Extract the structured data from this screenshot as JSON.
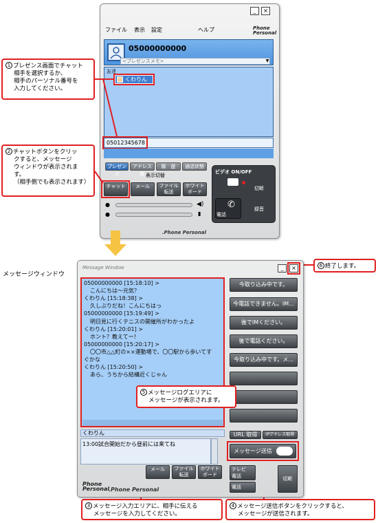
{
  "phone_app": {
    "menu": [
      "ファイル",
      "表示",
      "設定",
      "ヘルプ"
    ],
    "logo_lines": [
      "Phone",
      "Personal"
    ],
    "user_number": "05000000000",
    "presence_memo": "<プレゼンスメモ>",
    "group_label": "友達",
    "selected_contact": "くわりん",
    "personal_number_input": "05012345678",
    "tabs": [
      "プレゼンス",
      "アドレス帳",
      "履　歴",
      "通話状態"
    ],
    "tabs_caption": "表示切替",
    "chat_button": "チャット",
    "mail_button": "メール",
    "file_button": [
      "ファイル",
      "転送"
    ],
    "whiteboard_button": [
      "ホワイト",
      "ボード"
    ],
    "video_toggle": "ビデオ ON/OFF",
    "call_button": "電話",
    "hangup_label": "切断",
    "record_label": "録音",
    "footer_brand": ".Phone Personal"
  },
  "message_window": {
    "outside_label": "メッセージウィンドウ",
    "title": "Message Window",
    "log": [
      {
        "text": "05000000000 [15:18:10] >",
        "indent": false
      },
      {
        "text": "こんにちは～元気？",
        "indent": true
      },
      {
        "text": "くわりん [15:18:38] >",
        "indent": false
      },
      {
        "text": "久しぶりだね！こんにちはっ",
        "indent": true
      },
      {
        "text": "05000000000 [15:19:49] >",
        "indent": false
      },
      {
        "text": "明日見に行くテニスの開催所がわかったよ",
        "indent": true
      },
      {
        "text": "くわりん [15:20:01] >",
        "indent": false
      },
      {
        "text": "ホント？教えてー！",
        "indent": true
      },
      {
        "text": "05000000000 [15:20:17] >",
        "indent": false
      },
      {
        "text": "〇〇市△△町の××運動場で、〇〇駅から歩いてす",
        "indent": true
      },
      {
        "text": "ぐかな",
        "indent": false
      },
      {
        "text": "くわりん [15:20:50] >",
        "indent": false
      },
      {
        "text": "あら、うちから結構近くじゃん",
        "indent": true
      }
    ],
    "quick_replies": [
      "今取り込み中です。",
      "今電話できません。IM...",
      "後でIMください。",
      "後で電話ください。",
      "今取り込み中です。メ..."
    ],
    "recipient_name": "くわりん",
    "input_text": "13:00試合開始だから昼前には来てね",
    "url_button": "URL 取得",
    "ip_button": "IPアドレス取得",
    "send_button": "メッセージ送信",
    "mail_button": "メール",
    "file_button": [
      "ファイル",
      "転送"
    ],
    "whiteboard_button": [
      "ホワイト",
      "ボード"
    ],
    "tv_call_button": [
      "テレビ",
      "電話"
    ],
    "call_button": "電話",
    "hangup_button": "切断",
    "footer_logo": [
      "Phone",
      "Personal"
    ],
    "footer_brand": ".Phone Personal"
  },
  "callouts": {
    "c1": {
      "num": "1",
      "lines": [
        "プレゼンス画面でチャット",
        "相手を選択するか、",
        "相手のパーソナル番号を",
        "入力してください。"
      ]
    },
    "c2": {
      "num": "2",
      "lines": [
        "チャットボタンをクリッ",
        "クすると、メッセージ",
        "ウィンドウが表示されま",
        "す。",
        "（相手側でも表示されます）"
      ]
    },
    "c3": {
      "num": "3",
      "text": "メッセージ入力エリアに、相手に伝える",
      "text2": "メッセージを入力してください。"
    },
    "c4": {
      "num": "4",
      "text": "メッセージ送信ボタンをクリックすると、",
      "text2": "メッセージが送信されます。"
    },
    "c5": {
      "num": "5",
      "text": "メッセージログエリアに",
      "text2": "メッセージが表示されます。"
    },
    "c6": {
      "num": "6",
      "text": "終了します。"
    }
  }
}
